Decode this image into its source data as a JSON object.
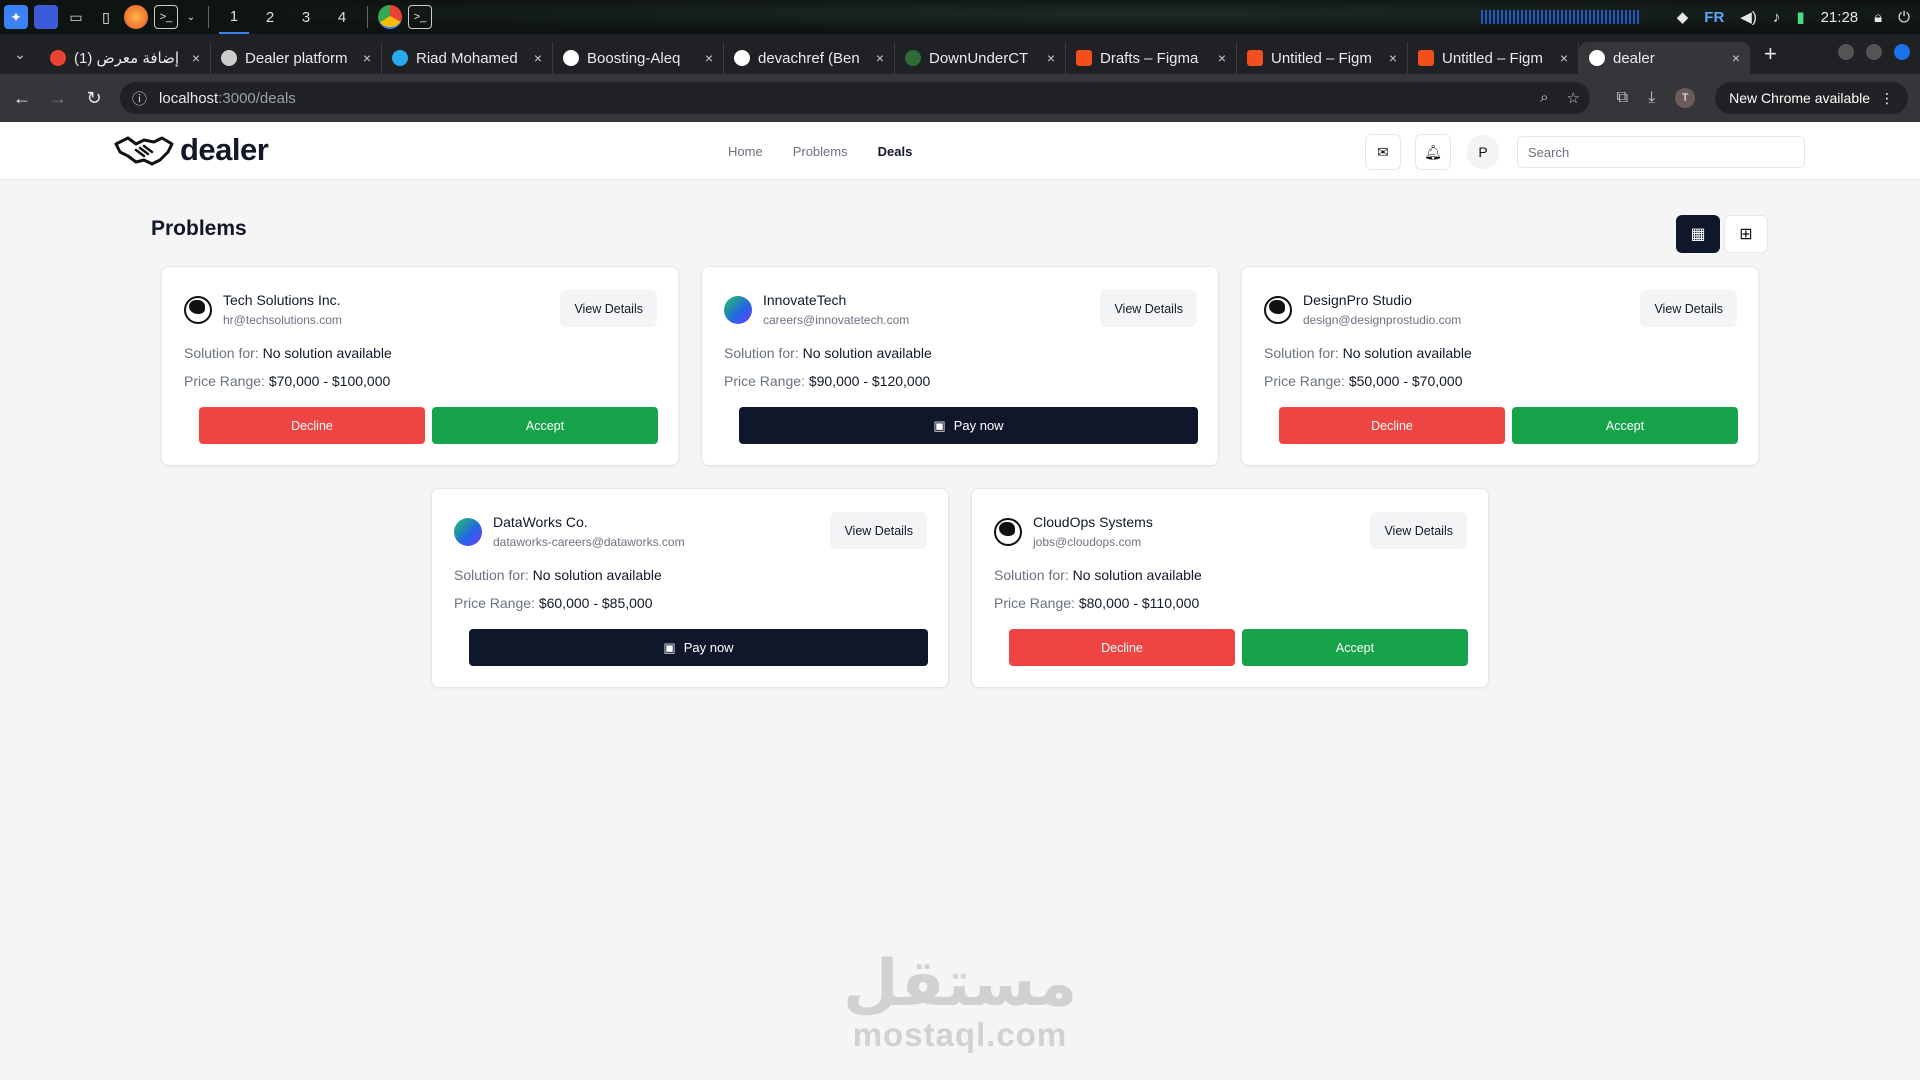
{
  "taskbar": {
    "workspaces": [
      "1",
      "2",
      "3",
      "4"
    ],
    "keyboard_layout": "FR",
    "clock": "21:28",
    "icons": [
      "app-menu-icon",
      "files-icon",
      "folder-icon",
      "document-icon",
      "firefox-icon",
      "terminal-icon",
      "chrome-icon",
      "terminal-icon",
      "wifi-icon",
      "volume-icon",
      "bell-icon",
      "battery-icon",
      "lock-icon"
    ]
  },
  "browser": {
    "tabs": [
      {
        "title": "(1) إضافة معرض",
        "close": "×"
      },
      {
        "title": "Dealer platform",
        "close": "×"
      },
      {
        "title": "Riad Mohamed",
        "close": "×"
      },
      {
        "title": "Boosting-Aleq",
        "close": "×"
      },
      {
        "title": "devachref (Ben",
        "close": "×"
      },
      {
        "title": "DownUnderCT",
        "close": "×"
      },
      {
        "title": "Drafts – Figma",
        "close": "×"
      },
      {
        "title": "Untitled – Figm",
        "close": "×"
      },
      {
        "title": "Untitled – Figm",
        "close": "×"
      },
      {
        "title": "dealer",
        "close": "×"
      }
    ],
    "new_tab": "+",
    "url_host": "localhost",
    "url_path": ":3000/deals",
    "profile_initial": "T",
    "update_label": "New Chrome available"
  },
  "app": {
    "brand": "dealer",
    "nav": {
      "home": "Home",
      "problems": "Problems",
      "deals": "Deals"
    },
    "user_initial": "P",
    "search_placeholder": "Search"
  },
  "page": {
    "title": "Problems",
    "solution_label": "Solution for:",
    "price_label": "Price Range:",
    "view_details": "View Details",
    "decline": "Decline",
    "accept": "Accept",
    "pay_now": "Pay now",
    "cards": [
      {
        "name": "Tech Solutions Inc.",
        "email": "hr@techsolutions.com",
        "solution": "No solution available",
        "price": "$70,000 - $100,000",
        "status": "pending",
        "avatar": "sketch"
      },
      {
        "name": "InnovateTech",
        "email": "careers@innovatetech.com",
        "solution": "No solution available",
        "price": "$90,000 - $120,000",
        "status": "payable",
        "avatar": "gradient"
      },
      {
        "name": "DesignPro Studio",
        "email": "design@designprostudio.com",
        "solution": "No solution available",
        "price": "$50,000 - $70,000",
        "status": "pending",
        "avatar": "sketch"
      },
      {
        "name": "DataWorks Co.",
        "email": "dataworks-careers@dataworks.com",
        "solution": "No solution available",
        "price": "$60,000 - $85,000",
        "status": "payable",
        "avatar": "gradient"
      },
      {
        "name": "CloudOps Systems",
        "email": "jobs@cloudops.com",
        "solution": "No solution available",
        "price": "$80,000 - $110,000",
        "status": "pending",
        "avatar": "sketch"
      }
    ]
  },
  "watermark": {
    "arabic": "مستقل",
    "latin": "mostaql.com"
  },
  "colors": {
    "decline": "#ef4444",
    "accept": "#16a34a",
    "primary": "#0f172a",
    "page_bg": "#f5f5f5"
  }
}
